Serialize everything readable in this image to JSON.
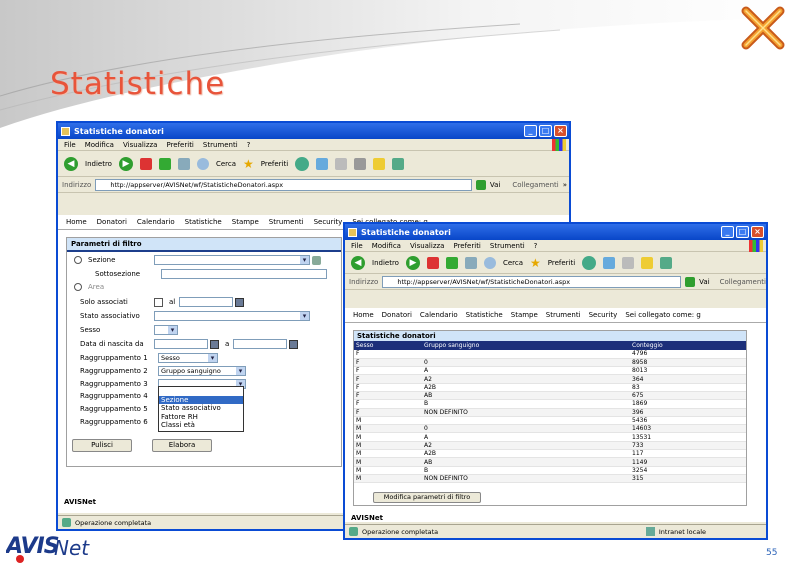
{
  "slide": {
    "title": "Statistiche",
    "page_number": "55",
    "brand_logo": "AVISNet"
  },
  "win1": {
    "title": "Statistiche donatori",
    "menu": [
      "File",
      "Modifica",
      "Visualizza",
      "Preferiti",
      "Strumenti",
      "?"
    ],
    "toolbar": {
      "back": "Indietro",
      "search": "Cerca",
      "favorites": "Preferiti"
    },
    "address": {
      "label": "Indirizzo",
      "url": "http://appserver/AVISNet/wf/StatisticheDonatori.aspx",
      "go": "Vai",
      "links": "Collegamenti"
    },
    "nav": [
      "Home",
      "Donatori",
      "Calendario",
      "Statistiche",
      "Stampe",
      "Strumenti",
      "Security",
      "Sei collegato come: g"
    ],
    "panel_title": "Parametri di filtro",
    "form": {
      "sezione": "Sezione",
      "sottosezione": "Sottosezione",
      "area": "Area",
      "solo_associati": "Solo associati",
      "al": "al",
      "stato_associativo": "Stato associativo",
      "sesso": "Sesso",
      "data_nascita": "Data di nascita da",
      "a": "a",
      "r1": "Raggruppamento 1",
      "r2": "Raggruppamento 2",
      "r3": "Raggruppamento 3",
      "r4": "Raggruppamento 4",
      "r5": "Raggruppamento 5",
      "r6": "Raggruppamento 6",
      "r1_val": "Sesso",
      "r2_val": "Gruppo sanguigno"
    },
    "dropdown": [
      "Sezione",
      "Stato associativo",
      "Fattore RH",
      "Classi età"
    ],
    "buttons": {
      "pulisci": "Pulisci",
      "elabora": "Elabora"
    },
    "footer": "AVISNet",
    "status": "Operazione completata"
  },
  "win2": {
    "title": "Statistiche donatori",
    "menu": [
      "File",
      "Modifica",
      "Visualizza",
      "Preferiti",
      "Strumenti",
      "?"
    ],
    "toolbar": {
      "back": "Indietro",
      "search": "Cerca",
      "favorites": "Preferiti"
    },
    "address": {
      "label": "Indirizzo",
      "url": "http://appserver/AVISNet/wf/StatisticheDonatori.aspx",
      "go": "Vai",
      "links": "Collegamenti"
    },
    "nav": [
      "Home",
      "Donatori",
      "Calendario",
      "Statistiche",
      "Stampe",
      "Strumenti",
      "Security",
      "Sei collegato come: g"
    ],
    "table_title": "Statistiche donatori",
    "columns": [
      "Sesso",
      "Gruppo sanguigno",
      "Conteggio"
    ],
    "rows": [
      [
        "F",
        "",
        "4796"
      ],
      [
        "F",
        "0",
        "8958"
      ],
      [
        "F",
        "A",
        "8013"
      ],
      [
        "F",
        "A2",
        "364"
      ],
      [
        "F",
        "A2B",
        "83"
      ],
      [
        "F",
        "AB",
        "675"
      ],
      [
        "F",
        "B",
        "1869"
      ],
      [
        "F",
        "NON DEFINITO",
        "396"
      ],
      [
        "M",
        "",
        "5436"
      ],
      [
        "M",
        "0",
        "14603"
      ],
      [
        "M",
        "A",
        "13531"
      ],
      [
        "M",
        "A2",
        "733"
      ],
      [
        "M",
        "A2B",
        "117"
      ],
      [
        "M",
        "AB",
        "1149"
      ],
      [
        "M",
        "B",
        "3254"
      ],
      [
        "M",
        "NON DEFINITO",
        "315"
      ]
    ],
    "modify_button": "Modifica parametri di filtro",
    "footer": "AVISNet",
    "status": "Operazione completata",
    "zone": "Intranet locale"
  }
}
